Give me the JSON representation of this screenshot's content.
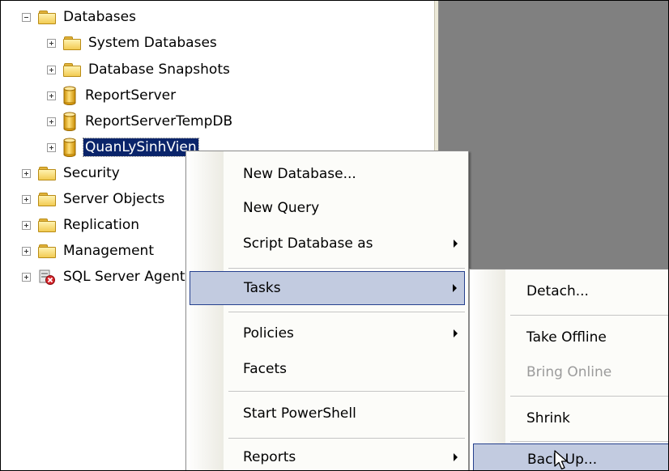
{
  "tree": {
    "items": [
      {
        "label": "Databases",
        "expander": "minus",
        "icon": "folder-icon"
      },
      {
        "label": "System Databases",
        "expander": "plus",
        "icon": "folder-icon"
      },
      {
        "label": "Database Snapshots",
        "expander": "plus",
        "icon": "folder-icon"
      },
      {
        "label": "ReportServer",
        "expander": "plus",
        "icon": "database-icon"
      },
      {
        "label": "ReportServerTempDB",
        "expander": "plus",
        "icon": "database-icon"
      },
      {
        "label": "QuanLySinhVien",
        "expander": "plus",
        "icon": "database-icon",
        "selected": true
      },
      {
        "label": "Security",
        "expander": "plus",
        "icon": "folder-icon"
      },
      {
        "label": "Server Objects",
        "expander": "plus",
        "icon": "folder-icon"
      },
      {
        "label": "Replication",
        "expander": "plus",
        "icon": "folder-icon"
      },
      {
        "label": "Management",
        "expander": "plus",
        "icon": "folder-icon"
      },
      {
        "label": "SQL Server Agent",
        "expander": "plus",
        "icon": "sql-agent-icon"
      }
    ]
  },
  "context_menu": {
    "items": [
      {
        "label": "New Database..."
      },
      {
        "label": "New Query"
      },
      {
        "label": "Script Database as",
        "submenu": true
      },
      {
        "label": "Tasks",
        "submenu": true,
        "highlighted": true
      },
      {
        "label": "Policies",
        "submenu": true
      },
      {
        "label": "Facets"
      },
      {
        "label": "Start PowerShell"
      },
      {
        "label": "Reports",
        "submenu": true
      }
    ]
  },
  "tasks_submenu": {
    "items": [
      {
        "label": "Detach..."
      },
      {
        "label": "Take Offline"
      },
      {
        "label": "Bring Online",
        "disabled": true
      },
      {
        "label": "Shrink"
      },
      {
        "label": "Back Up...",
        "highlighted": true
      }
    ]
  },
  "colors": {
    "selection": "#0a246a",
    "menu_highlight": "#c2cbe0",
    "menu_highlight_border": "#26418e",
    "details_panel": "#808080"
  }
}
